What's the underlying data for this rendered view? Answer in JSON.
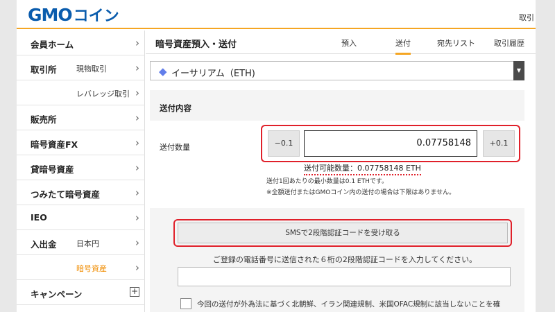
{
  "header": {
    "logo_gmo": "GMO",
    "logo_coin": "コイン",
    "right_text": "取引"
  },
  "sidebar": {
    "items": [
      {
        "main": "会員ホーム",
        "sub": "",
        "icon": "chevron-right"
      },
      {
        "main": "取引所",
        "sub": "現物取引",
        "icon": "chevron-right"
      },
      {
        "main": "",
        "sub": "レバレッジ取引",
        "icon": "chevron-right"
      },
      {
        "main": "販売所",
        "sub": "",
        "icon": "chevron-right"
      },
      {
        "main": "暗号資産FX",
        "sub": "",
        "icon": "chevron-right"
      },
      {
        "main": "貸暗号資産",
        "sub": "",
        "icon": "chevron-right"
      },
      {
        "main": "つみたて暗号資産",
        "sub": "",
        "icon": "chevron-right"
      },
      {
        "main": "IEO",
        "sub": "",
        "icon": "chevron-right"
      },
      {
        "main": "入出金",
        "sub": "日本円",
        "icon": "chevron-right"
      },
      {
        "main": "",
        "sub": "暗号資産",
        "icon": "chevron-right",
        "active": true
      },
      {
        "main": "キャンペーン",
        "sub": "",
        "icon": "plus-box"
      }
    ],
    "chevron": "›",
    "plus": "+"
  },
  "main": {
    "title": "暗号資産預入・送付",
    "tabs": [
      {
        "label": "預入",
        "active": false
      },
      {
        "label": "送付",
        "active": true
      },
      {
        "label": "宛先リスト",
        "active": false
      },
      {
        "label": "取引履歴",
        "active": false
      }
    ],
    "coin_select": {
      "icon": "ethereum-icon",
      "value": "イーサリアム（ETH)",
      "arrow": "▼"
    },
    "section_title": "送付内容",
    "quantity_label": "送付数量",
    "minus_button": "−0.1",
    "quantity_value": "0.07758148",
    "plus_button": "+0.1",
    "available": "送付可能数量：0.07758148 ETH",
    "notes": [
      "送付1回あたりの最小数量は0.1 ETHです。",
      "※全額送付またはGMOコイン内の送付の場合は下限はありません。"
    ],
    "sms_button": "SMSで2段階認証コードを受け取る",
    "sms_description": "ご登録の電話番号に送信された６桁の2段階認証コードを入力してください。",
    "code_placeholder": "",
    "checkbox_text": "今回の送付が外為法に基づく北朝鮮、イラン関連規制、米国OFAC規制に該当しないことを確"
  },
  "colors": {
    "brand_blue": "#0a5cad",
    "accent_orange": "#f5a623",
    "active_sub": "#f08c00",
    "highlight_red": "#e0202a"
  }
}
